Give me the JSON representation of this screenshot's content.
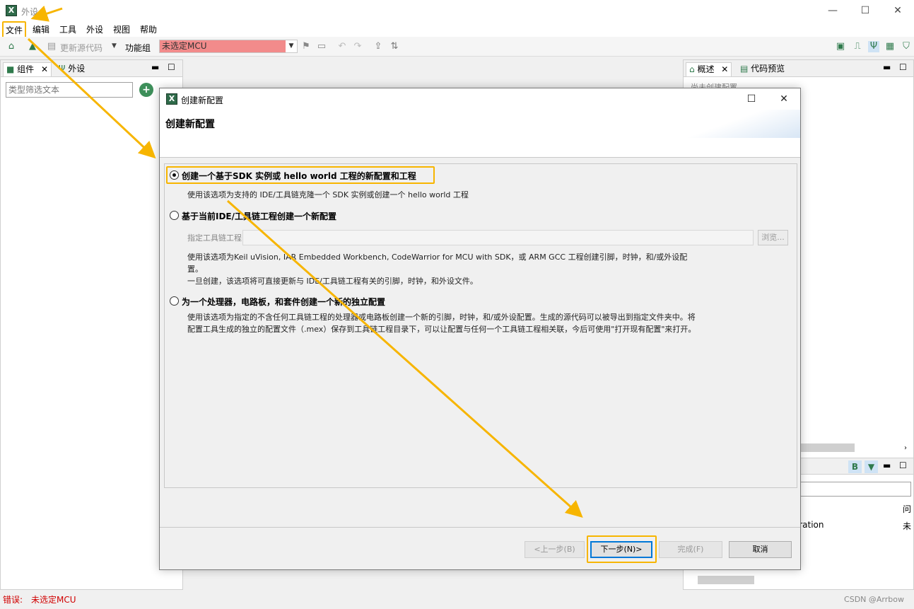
{
  "window": {
    "title": "外设",
    "minimize": "—",
    "maximize": "☐",
    "close": "✕"
  },
  "menu": [
    "文件",
    "编辑",
    "工具",
    "外设",
    "视图",
    "帮助"
  ],
  "toolbar": {
    "update_code": "更新源代码",
    "function_group": "功能组",
    "mcu_placeholder": "未选定MCU",
    "dropdown_arrow": "▼"
  },
  "left_panel": {
    "tabs": [
      "组件",
      "外设"
    ],
    "filter_placeholder": "类型筛选文本",
    "add_label": "+"
  },
  "right_panel": {
    "tabs": [
      "概述",
      "代码预览"
    ],
    "overview_text": "尚未创建配置",
    "table_header_1": "问",
    "table_cell_1": "guration",
    "table_cell_2": "未"
  },
  "dialog": {
    "title": "创建新配置",
    "heading": "创建新配置",
    "options": [
      {
        "label": "创建一个基于SDK 实例或 hello world 工程的新配置和工程",
        "selected": true,
        "desc": [
          "使用该选项为支持的 IDE/工具链克隆一个 SDK 实例或创建一个 hello world 工程"
        ]
      },
      {
        "label": "基于当前IDE/工具链工程创建一个新配置",
        "selected": false,
        "toolchain_label": "指定工具链工程:",
        "browse": "浏览...",
        "desc": [
          "使用该选项为Keil uVision, IAR Embedded Workbench, CodeWarrior for MCU with SDK，或 ARM GCC 工程创建引脚，时钟，和/或外设配",
          "置。",
          "一旦创建，该选项将可直接更新与 IDE/工具链工程有关的引脚，时钟，和外设文件。"
        ]
      },
      {
        "label": "为一个处理器，电路板，和套件创建一个新的独立配置",
        "selected": false,
        "desc": [
          "使用该选项为指定的不含任何工具链工程的处理器或电路板创建一个新的引脚，时钟，和/或外设配置。生成的源代码可以被导出到指定文件夹中。将",
          "配置工具生成的独立的配置文件（.mex）保存到工具链工程目录下，可以让配置与任何一个工具链工程相关联，今后可使用\"打开现有配置\"来打开。"
        ]
      }
    ],
    "buttons": {
      "back": "<上一步(B)",
      "next": "下一步(N)>",
      "finish": "完成(F)",
      "cancel": "取消"
    }
  },
  "status": {
    "label": "错误:",
    "value": "未选定MCU"
  },
  "watermark": "CSDN @Arrbow",
  "colors": {
    "highlight": "#f7b500",
    "error": "#d00000",
    "mcu_bg": "#f28b8b",
    "accent": "#0078d7"
  }
}
